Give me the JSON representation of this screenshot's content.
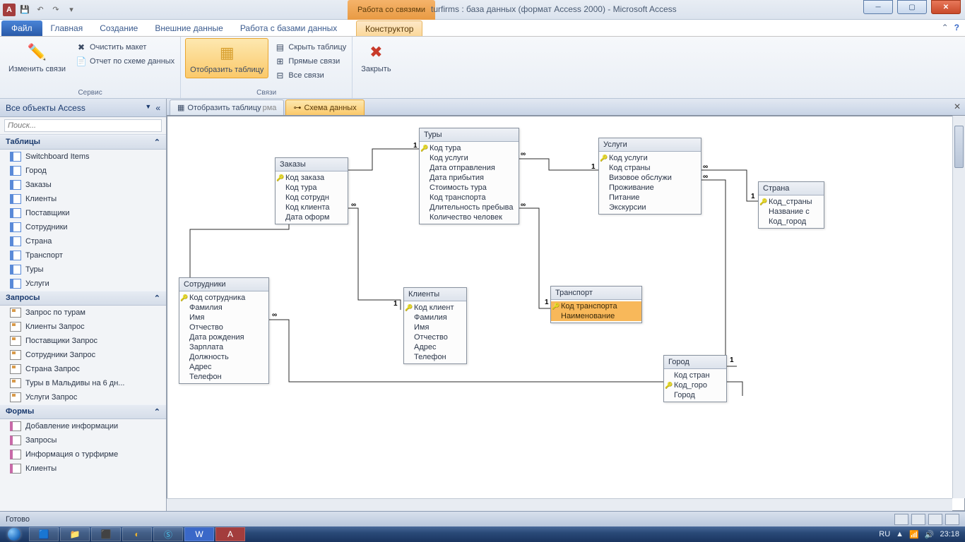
{
  "title": "turfirms : база данных (формат Access 2000)  -  Microsoft Access",
  "contextual_group": "Работа со связями",
  "ribbon_tabs": {
    "file": "Файл",
    "home": "Главная",
    "create": "Создание",
    "external": "Внешние данные",
    "dbtools": "Работа с базами данных",
    "design": "Конструктор"
  },
  "ribbon": {
    "edit_rel": "Изменить связи",
    "clear_layout": "Очистить макет",
    "rel_report": "Отчет по схеме данных",
    "group_service": "Сервис",
    "show_table": "Отобразить таблицу",
    "hide_table": "Скрыть таблицу",
    "direct_rel": "Прямые связи",
    "all_rel": "Все связи",
    "group_rel": "Связи",
    "close": "Закрыть"
  },
  "nav": {
    "header": "Все объекты Access",
    "search_ph": "Поиск...",
    "cat_tables": "Таблицы",
    "cat_queries": "Запросы",
    "cat_forms": "Формы",
    "tables": [
      "Switchboard Items",
      "Город",
      "Заказы",
      "Клиенты",
      "Поставщики",
      "Сотрудники",
      "Страна",
      "Транспорт",
      "Туры",
      "Услуги"
    ],
    "queries": [
      "Запрос по турам",
      "Клиенты Запрос",
      "Поставщики Запрос",
      "Сотрудники Запрос",
      "Страна Запрос",
      "Туры в Мальдивы на 6 дн...",
      "Услуги Запрос"
    ],
    "forms": [
      "Добавление информации",
      "Запросы",
      "Информация о турфирме",
      "Клиенты"
    ]
  },
  "doc_tabs": {
    "tab1": "Отобразить таблицу",
    "tab1_suffix": "рма",
    "tab2": "Схема данных"
  },
  "schema": {
    "zakazy": {
      "title": "Заказы",
      "fields": [
        "Код заказа",
        "Код тура",
        "Код сотрудн",
        "Код клиента",
        "Дата оформ"
      ]
    },
    "sotrudniki": {
      "title": "Сотрудники",
      "fields": [
        "Код сотрудника",
        "Фамилия",
        "Имя",
        "Отчество",
        "Дата рождения",
        "Зарплата",
        "Должность",
        "Адрес",
        "Телефон"
      ]
    },
    "tury": {
      "title": "Туры",
      "fields": [
        "Код тура",
        "Код услуги",
        "Дата отправления",
        "Дата прибытия",
        "Стоимость тура",
        "Код транспорта",
        "Длительность пребыва",
        "Количество человек"
      ]
    },
    "klienty": {
      "title": "Клиенты",
      "fields": [
        "Код клиент",
        "Фамилия",
        "Имя",
        "Отчество",
        "Адрес",
        "Телефон"
      ]
    },
    "uslugi": {
      "title": "Услуги",
      "fields": [
        "Код услуги",
        "Код страны",
        "Визовое обслужи",
        "Проживание",
        "Питание",
        "Экскурсии"
      ]
    },
    "transport": {
      "title": "Транспорт",
      "fields": [
        "Код транспорта",
        "Наименование"
      ]
    },
    "strana": {
      "title": "Страна",
      "fields": [
        "Код_страны",
        "Название с",
        "Код_город"
      ]
    },
    "gorod": {
      "title": "Город",
      "fields": [
        "Код стран",
        "Код_горо",
        "Город"
      ]
    }
  },
  "status": "Готово",
  "tray": {
    "lang": "RU",
    "time": "23:18"
  },
  "inf": "∞",
  "one": "1",
  "chev": "«",
  "expand": "⌄",
  "coll": "⌃"
}
